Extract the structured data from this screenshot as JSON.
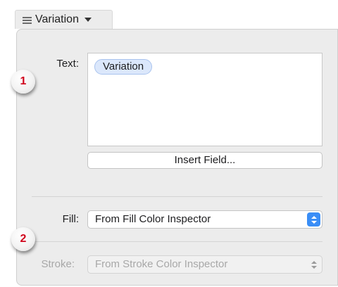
{
  "header": {
    "menu_label": "Variation",
    "menu_icon": "list-icon"
  },
  "text_section": {
    "label": "Text:",
    "token": "Variation",
    "insert_button": "Insert Field..."
  },
  "fill_section": {
    "label": "Fill:",
    "value": "From Fill Color Inspector",
    "state": "enabled"
  },
  "stroke_section": {
    "label": "Stroke:",
    "value": "From Stroke Color Inspector",
    "state": "disabled"
  },
  "callouts": [
    "1",
    "2"
  ],
  "colors": {
    "accent": "#3a8ef6",
    "callout_number": "#d0021b",
    "token_bg": "#dbe7fb",
    "panel_bg": "#ececec",
    "disabled_text": "#a8a8a8"
  }
}
